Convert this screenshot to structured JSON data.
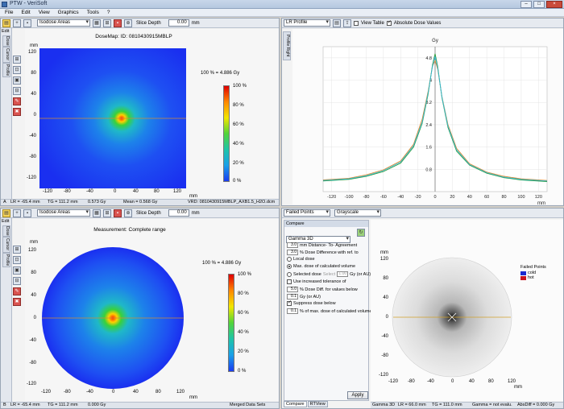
{
  "app": {
    "title": "PTW - VeriSoft"
  },
  "menu": [
    "File",
    "Edit",
    "View",
    "Graphics",
    "Tools",
    "?"
  ],
  "window_controls": {
    "minimize": "–",
    "maximize": "□",
    "close": "×"
  },
  "toolbar_common": {
    "slice_depth_label": "Slice Depth",
    "unit": "mm"
  },
  "sidebar": {
    "edit_label": "Edit",
    "tabs": [
      "Dose",
      "Cursor",
      "Profile"
    ]
  },
  "top_left": {
    "mode": "Isodose Areas",
    "slice_depth": "0.00",
    "title": "DoseMap: ID: 0810430915MBLP",
    "ref_label": "100 % = 4.886 Gy",
    "colorbar_ticks": [
      "100 %",
      "80 %",
      "60 %",
      "40 %",
      "20 %",
      "0 %"
    ],
    "x_ticks": [
      "-120",
      "-80",
      "-40",
      "0",
      "40",
      "80",
      "120"
    ],
    "y_ticks": [
      "120",
      "80",
      "40",
      "0",
      "-40",
      "-80",
      "-120"
    ],
    "y_unit": "mm",
    "x_unit": "mm",
    "status": {
      "a": "A",
      "lr": "LR = -65.4 mm",
      "tg": "TG = 111.2 mm",
      "dose": "0.573 Gy",
      "mean": "Mean = 0.568 Gy",
      "file": "VRD: 0810430915MBLP_AXB1.5_H2O.dcm"
    }
  },
  "top_right": {
    "mode": "LR Profile",
    "view_table": "View Table",
    "absolute_dose": "Absolute Dose Values",
    "side_tab": "Profile Right",
    "y_unit": "Gy",
    "x_unit": "mm"
  },
  "bottom_left": {
    "mode": "Isodose Areas",
    "slice_depth": "0.00",
    "title": "Measurement: Complete range",
    "ref_label": "100 % = 4.886 Gy",
    "colorbar_ticks": [
      "100 %",
      "80 %",
      "60 %",
      "40 %",
      "20 %",
      "0 %"
    ],
    "x_ticks": [
      "-120",
      "-80",
      "-40",
      "0",
      "40",
      "80",
      "120"
    ],
    "y_ticks": [
      "120",
      "80",
      "40",
      "0",
      "-40",
      "-80",
      "-120"
    ],
    "y_unit": "mm",
    "x_unit": "mm",
    "status": {
      "b": "B",
      "lr": "LR = -65.4 mm",
      "tg": "TG = 111.2 mm",
      "dose": "0.000 Gy",
      "file": "Merged Data Sets"
    }
  },
  "bottom_right": {
    "mode": "Failed Points",
    "palette": "Grayscale",
    "compare_header": "Compare",
    "method": "Gamma 3D",
    "params": {
      "dta_value": "3.0",
      "dta_label": "mm Distance- To- Agreement",
      "dd_value": "3.0",
      "dd_label": "% Dose Difference with ref. to",
      "local_label": "Local dose",
      "max_label": "Max. dose of calculated volume",
      "selected_label": "Selected dose",
      "selected_hint": "Select",
      "selected_value": "1.00",
      "selected_unit": "Gy (or AU)",
      "increased_label": "Use increased tolerance of",
      "inc_value": "5.0",
      "inc_label": "% Dose Diff. for values below",
      "inc2_value": "0.1",
      "inc2_label": "Gy (or AU)",
      "suppress_label": "Suppress dose below",
      "sup_value": "0.1",
      "sup_label": "% of max. dose of calculated volume"
    },
    "apply": "Apply",
    "tabs": [
      "Compare",
      "RTView"
    ],
    "legend_title": "Failed Points",
    "legend": [
      {
        "label": "cold",
        "color": "#1a2ad0"
      },
      {
        "label": "hot",
        "color": "#c8141e"
      }
    ],
    "x_ticks": [
      "-120",
      "-80",
      "-40",
      "0",
      "40",
      "80",
      "120"
    ],
    "y_ticks": [
      "120",
      "80",
      "40",
      "0",
      "-40",
      "-80",
      "-120"
    ],
    "y_unit": "mm",
    "x_unit": "mm",
    "status": {
      "method": "Gamma 3D",
      "lr": "LR = 66.0 mm",
      "tg": "TG = 111.0 mm",
      "gamma": "Gamma = not evalu.",
      "absdiff": "AbsDiff = 0.000 Gy"
    }
  },
  "chart_data": {
    "type": "line",
    "title": "",
    "ylabel": "Gy",
    "xlabel": "mm",
    "xlim": [
      -130,
      130
    ],
    "ylim": [
      0,
      5.2
    ],
    "x_ticks": [
      -120,
      -100,
      -80,
      -60,
      -40,
      -20,
      0,
      20,
      40,
      60,
      80,
      100,
      120
    ],
    "y_ticks": [
      0.8,
      1.6,
      2.4,
      3.2,
      4,
      4.8
    ],
    "series": [
      {
        "color": "#e08a2a",
        "points": [
          [
            -130,
            0.42
          ],
          [
            -100,
            0.48
          ],
          [
            -80,
            0.6
          ],
          [
            -60,
            0.78
          ],
          [
            -40,
            1.1
          ],
          [
            -25,
            1.7
          ],
          [
            -15,
            2.6
          ],
          [
            -8,
            3.6
          ],
          [
            -3,
            4.5
          ],
          [
            0,
            4.7
          ],
          [
            3,
            4.4
          ],
          [
            8,
            3.4
          ],
          [
            15,
            2.4
          ],
          [
            25,
            1.55
          ],
          [
            40,
            1.0
          ],
          [
            60,
            0.7
          ],
          [
            80,
            0.55
          ],
          [
            100,
            0.46
          ],
          [
            130,
            0.4
          ]
        ]
      },
      {
        "color": "#2a9a3a",
        "points": [
          [
            -130,
            0.38
          ],
          [
            -100,
            0.44
          ],
          [
            -80,
            0.55
          ],
          [
            -60,
            0.72
          ],
          [
            -40,
            1.02
          ],
          [
            -25,
            1.6
          ],
          [
            -15,
            2.45
          ],
          [
            -8,
            3.5
          ],
          [
            -3,
            4.55
          ],
          [
            0,
            4.95
          ],
          [
            3,
            4.5
          ],
          [
            8,
            3.35
          ],
          [
            15,
            2.3
          ],
          [
            25,
            1.45
          ],
          [
            40,
            0.95
          ],
          [
            60,
            0.66
          ],
          [
            80,
            0.5
          ],
          [
            100,
            0.42
          ],
          [
            130,
            0.36
          ]
        ]
      },
      {
        "color": "#33b8d8",
        "points": [
          [
            -130,
            0.4
          ],
          [
            -100,
            0.46
          ],
          [
            -80,
            0.57
          ],
          [
            -60,
            0.75
          ],
          [
            -40,
            1.06
          ],
          [
            -25,
            1.65
          ],
          [
            -15,
            2.5
          ],
          [
            -8,
            3.55
          ],
          [
            -3,
            4.5
          ],
          [
            0,
            4.85
          ],
          [
            3,
            4.45
          ],
          [
            8,
            3.38
          ],
          [
            15,
            2.35
          ],
          [
            25,
            1.5
          ],
          [
            40,
            0.97
          ],
          [
            60,
            0.68
          ],
          [
            80,
            0.52
          ],
          [
            100,
            0.44
          ],
          [
            130,
            0.38
          ]
        ]
      }
    ]
  }
}
